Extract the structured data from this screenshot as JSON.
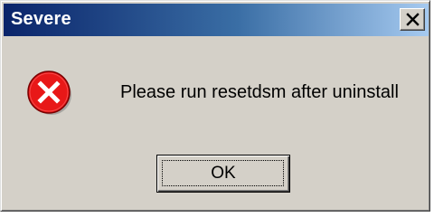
{
  "window": {
    "title": "Severe",
    "message": "Please run resetdsm after uninstall",
    "icon": "error-icon",
    "close_icon": "close-icon"
  },
  "buttons": {
    "ok_label": "OK"
  },
  "colors": {
    "titlebar_start": "#0a246a",
    "titlebar_end": "#a6caf0",
    "dialog_bg": "#d4d0c8",
    "error_red": "#e81818"
  }
}
